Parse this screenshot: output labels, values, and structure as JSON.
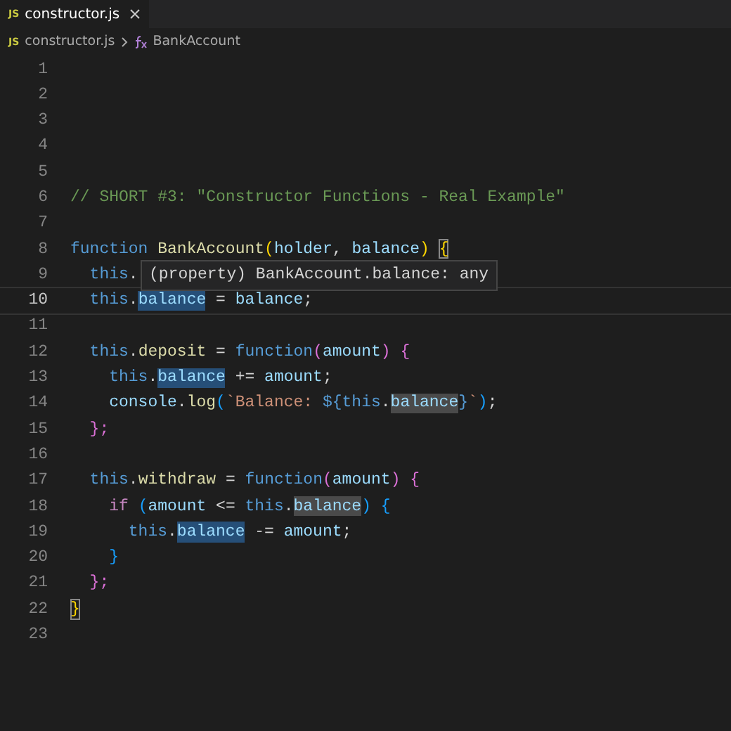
{
  "tabs": [
    {
      "icon_text": "JS",
      "label": "constructor.js",
      "selected": true
    }
  ],
  "breadcrumb": {
    "file_icon_text": "JS",
    "file": "constructor.js",
    "symbol": "BankAccount"
  },
  "lines": [
    {
      "number": "1",
      "current": false
    },
    {
      "number": "2",
      "current": false
    },
    {
      "number": "3",
      "current": false
    },
    {
      "number": "4",
      "current": false
    },
    {
      "number": "5",
      "current": false
    },
    {
      "number": "6",
      "current": false,
      "tokens": [
        {
          "text": "// SHORT #3: \"Constructor Functions - Real Example\"",
          "kind": "comment"
        }
      ]
    },
    {
      "number": "7",
      "current": false
    },
    {
      "number": "8",
      "current": false,
      "tokens": [
        {
          "text": "function ",
          "kind": "keyword"
        },
        {
          "text": "BankAccount",
          "kind": "function"
        },
        {
          "text": "(",
          "kind": "bracket1"
        },
        {
          "text": "holder",
          "kind": "variable"
        },
        {
          "text": ", ",
          "kind": "plain"
        },
        {
          "text": "balance",
          "kind": "variable"
        },
        {
          "text": ") ",
          "kind": "bracket1"
        },
        {
          "text": "{",
          "kind": "bracket1",
          "bracket_match": true
        }
      ]
    },
    {
      "number": "9",
      "current": false,
      "tokens": [
        {
          "text": "  this",
          "kind": "keyword"
        },
        {
          "text": ".",
          "kind": "plain"
        }
      ],
      "tooltip": "(property) BankAccount.balance: any"
    },
    {
      "number": "10",
      "current": true,
      "tokens": [
        {
          "text": "  this",
          "kind": "keyword"
        },
        {
          "text": ".",
          "kind": "plain"
        },
        {
          "text": "balance",
          "kind": "variable",
          "write_highlight": true
        },
        {
          "text": " = ",
          "kind": "plain"
        },
        {
          "text": "balance",
          "kind": "variable"
        },
        {
          "text": ";",
          "kind": "plain"
        }
      ]
    },
    {
      "number": "11",
      "current": false
    },
    {
      "number": "12",
      "current": false,
      "tokens": [
        {
          "text": "  this",
          "kind": "keyword"
        },
        {
          "text": ".",
          "kind": "plain"
        },
        {
          "text": "deposit",
          "kind": "function"
        },
        {
          "text": " = ",
          "kind": "plain"
        },
        {
          "text": "function",
          "kind": "keyword"
        },
        {
          "text": "(",
          "kind": "bracket2"
        },
        {
          "text": "amount",
          "kind": "variable"
        },
        {
          "text": ") {",
          "kind": "bracket2"
        }
      ]
    },
    {
      "number": "13",
      "current": false,
      "tokens": [
        {
          "text": "    this",
          "kind": "keyword"
        },
        {
          "text": ".",
          "kind": "plain"
        },
        {
          "text": "balance",
          "kind": "variable",
          "write_highlight": true
        },
        {
          "text": " += ",
          "kind": "plain"
        },
        {
          "text": "amount",
          "kind": "variable"
        },
        {
          "text": ";",
          "kind": "plain"
        }
      ]
    },
    {
      "number": "14",
      "current": false,
      "tokens": [
        {
          "text": "    console",
          "kind": "variable"
        },
        {
          "text": ".",
          "kind": "plain"
        },
        {
          "text": "log",
          "kind": "function"
        },
        {
          "text": "(",
          "kind": "bracket3"
        },
        {
          "text": "`Balance: ",
          "kind": "string"
        },
        {
          "text": "${",
          "kind": "keyword"
        },
        {
          "text": "this",
          "kind": "keyword"
        },
        {
          "text": ".",
          "kind": "plain"
        },
        {
          "text": "balance",
          "kind": "variable",
          "read_highlight": true
        },
        {
          "text": "}",
          "kind": "keyword"
        },
        {
          "text": "`",
          "kind": "string"
        },
        {
          "text": ")",
          "kind": "bracket3"
        },
        {
          "text": ";",
          "kind": "plain"
        }
      ]
    },
    {
      "number": "15",
      "current": false,
      "tokens": [
        {
          "text": "  };",
          "kind": "bracket2"
        }
      ]
    },
    {
      "number": "16",
      "current": false
    },
    {
      "number": "17",
      "current": false,
      "tokens": [
        {
          "text": "  this",
          "kind": "keyword"
        },
        {
          "text": ".",
          "kind": "plain"
        },
        {
          "text": "withdraw",
          "kind": "function"
        },
        {
          "text": " = ",
          "kind": "plain"
        },
        {
          "text": "function",
          "kind": "keyword"
        },
        {
          "text": "(",
          "kind": "bracket2"
        },
        {
          "text": "amount",
          "kind": "variable"
        },
        {
          "text": ") {",
          "kind": "bracket2"
        }
      ]
    },
    {
      "number": "18",
      "current": false,
      "tokens": [
        {
          "text": "    if ",
          "kind": "control"
        },
        {
          "text": "(",
          "kind": "bracket3"
        },
        {
          "text": "amount",
          "kind": "variable"
        },
        {
          "text": " <= ",
          "kind": "plain"
        },
        {
          "text": "this",
          "kind": "keyword"
        },
        {
          "text": ".",
          "kind": "plain"
        },
        {
          "text": "balance",
          "kind": "variable",
          "read_highlight": true
        },
        {
          "text": ") {",
          "kind": "bracket3"
        }
      ]
    },
    {
      "number": "19",
      "current": false,
      "tokens": [
        {
          "text": "      this",
          "kind": "keyword"
        },
        {
          "text": ".",
          "kind": "plain"
        },
        {
          "text": "balance",
          "kind": "variable",
          "write_highlight": true
        },
        {
          "text": " -= ",
          "kind": "plain"
        },
        {
          "text": "amount",
          "kind": "variable"
        },
        {
          "text": ";",
          "kind": "plain"
        }
      ]
    },
    {
      "number": "20",
      "current": false,
      "tokens": [
        {
          "text": "    }",
          "kind": "bracket3"
        }
      ]
    },
    {
      "number": "21",
      "current": false,
      "tokens": [
        {
          "text": "  };",
          "kind": "bracket2"
        }
      ]
    },
    {
      "number": "22",
      "current": false,
      "tokens": [
        {
          "text": "}",
          "kind": "bracket1",
          "bracket_match": true
        }
      ]
    },
    {
      "number": "23",
      "current": false
    }
  ]
}
